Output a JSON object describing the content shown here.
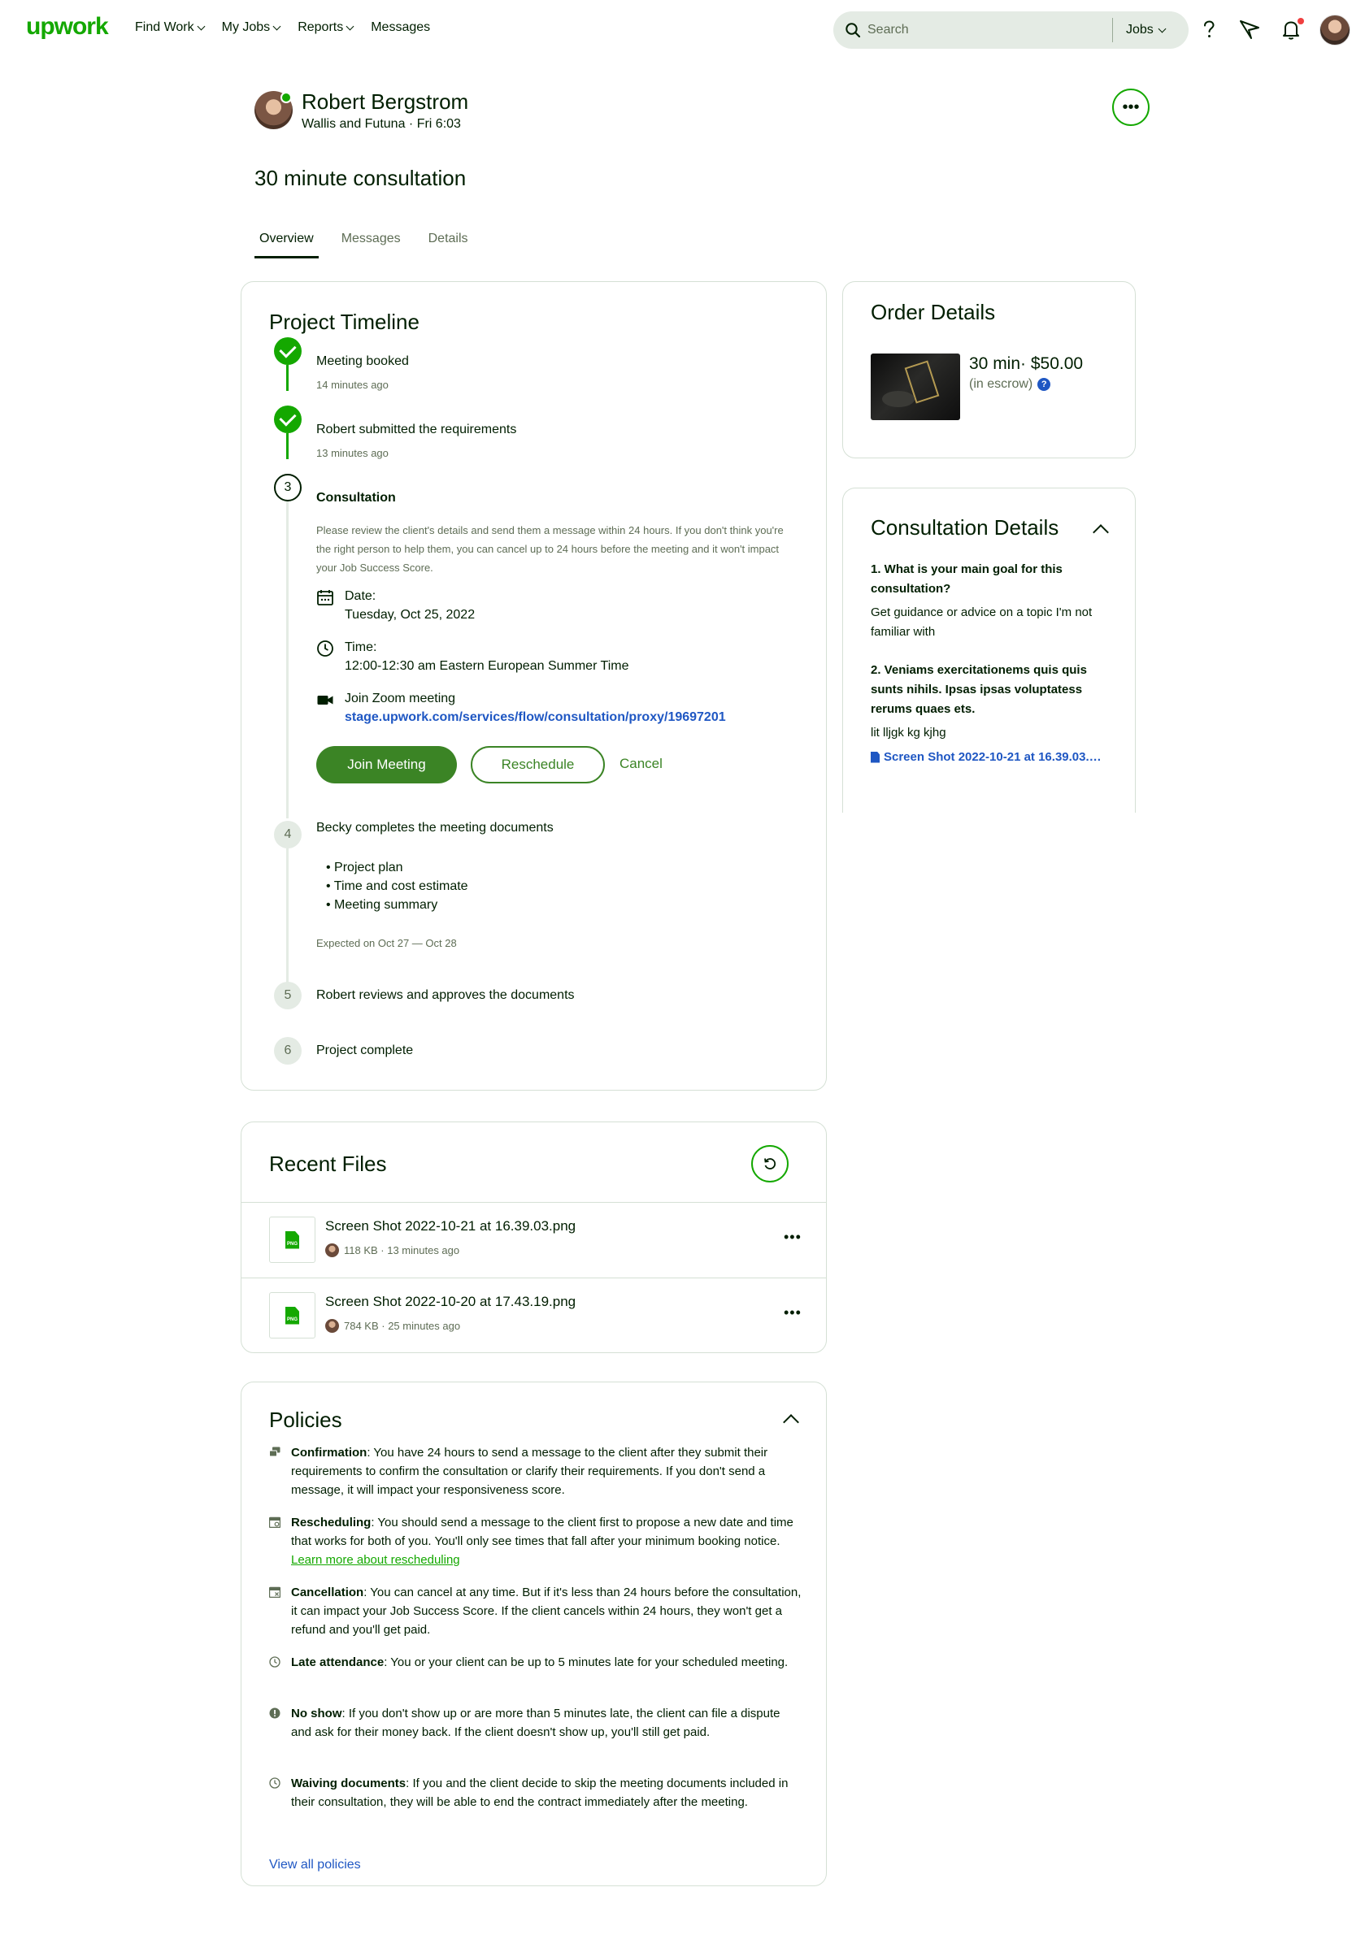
{
  "header": {
    "logo": "upwork",
    "nav": [
      "Find Work",
      "My Jobs",
      "Reports",
      "Messages"
    ],
    "search_placeholder": "Search",
    "search_scope": "Jobs",
    "icons": [
      "help-icon",
      "send-icon",
      "bell-icon",
      "avatar"
    ]
  },
  "profile": {
    "name": "Robert Bergstrom",
    "location": "Wallis and Futuna · Fri 6:03",
    "online": true
  },
  "page_title": "30 minute consultation",
  "tabs": [
    "Overview",
    "Messages",
    "Details"
  ],
  "active_tab": "Overview",
  "timeline": {
    "title": "Project Timeline",
    "steps": [
      {
        "number": "1",
        "status": "done",
        "title": "Meeting booked",
        "sub": "14 minutes ago"
      },
      {
        "number": "2",
        "status": "done",
        "title": "Robert submitted the requirements",
        "sub": "13 minutes ago"
      },
      {
        "number": "3",
        "status": "current",
        "title": "Consultation",
        "description": "Please review the client's details and send them a message within 24 hours. If you don't think you're the right person to help them, you can cancel up to 24 hours before the meeting and it won't impact your Job Success Score.",
        "date_label": "Date:",
        "date_value": "Tuesday, Oct 25, 2022",
        "time_label": "Time:",
        "time_value": "12:00-12:30 am Eastern European Summer Time",
        "zoom_label": "Join Zoom meeting",
        "zoom_link": "stage.upwork.com/services/flow/consultation/proxy/19697201",
        "join_label": "Join Meeting",
        "reschedule_label": "Reschedule",
        "cancel_label": "Cancel"
      },
      {
        "number": "4",
        "status": "pending",
        "title": "Becky completes the meeting documents",
        "items": [
          "Project plan",
          "Time and cost estimate",
          "Meeting summary"
        ],
        "expected": "Expected on Oct 27 — Oct 28"
      },
      {
        "number": "5",
        "status": "pending",
        "title": "Robert reviews and approves the documents"
      },
      {
        "number": "6",
        "status": "pending",
        "title": "Project complete"
      }
    ]
  },
  "order": {
    "title": "Order Details",
    "price": "30 min· $50.00",
    "escrow": "(in escrow)"
  },
  "consultation": {
    "title": "Consultation Details",
    "q1": "1. What is your main goal for this consultation?",
    "a1": "Get guidance or advice on a topic I'm not familiar with",
    "q2": "2. Veniams exercitationems quis quis sunts nihils. Ipsas ipsas voluptatess rerums quaes ets.",
    "a2": "lit lljgk kg kjhg",
    "file": "Screen Shot 2022-10-21 at 16.39.03.png"
  },
  "recent_files": {
    "title": "Recent Files",
    "files": [
      {
        "name": "Screen Shot 2022-10-21 at 16.39.03.png",
        "meta": "118 KB · 13 minutes ago",
        "type": "PNG"
      },
      {
        "name": "Screen Shot 2022-10-20 at 17.43.19.png",
        "meta": "784 KB · 25 minutes ago",
        "type": "PNG"
      }
    ]
  },
  "policies": {
    "title": "Policies",
    "items": [
      {
        "term": "Confirmation",
        "text": ": You have 24 hours to send a message to the client after they submit their requirements to confirm the consultation or clarify their requirements. If you don't send a message, it will impact your responsiveness score."
      },
      {
        "term": "Rescheduling",
        "text": ": You should send a message to the client first to propose a new date and time that works for both of you. You'll only see times that fall after your minimum booking notice. ",
        "link": "Learn more about rescheduling"
      },
      {
        "term": "Cancellation",
        "text": ": You can cancel at any time. But if it's less than 24 hours before the consultation, it can impact your Job Success Score. If the client cancels within 24 hours, they won't get a refund and you'll get paid."
      },
      {
        "term": "Late attendance",
        "text": ": You or your client can be up to 5 minutes late for your scheduled meeting."
      },
      {
        "term": "No show",
        "text": ": If you don't show up or are more than 5 minutes late, the client can file a dispute and ask for their money back. If the client doesn't show up, you'll still get paid."
      },
      {
        "term": "Waiving documents",
        "text": ": If you and the client decide to skip the meeting documents included in their consultation, they will be able to end the contract immediately after the meeting."
      }
    ],
    "view_all": "View all policies"
  },
  "colors": {
    "brand_green": "#14a800",
    "button_green": "#3b8425",
    "link_blue": "#1f57c3",
    "text": "#001e00",
    "muted": "#5e6d55",
    "notification": "#f03f3f"
  }
}
